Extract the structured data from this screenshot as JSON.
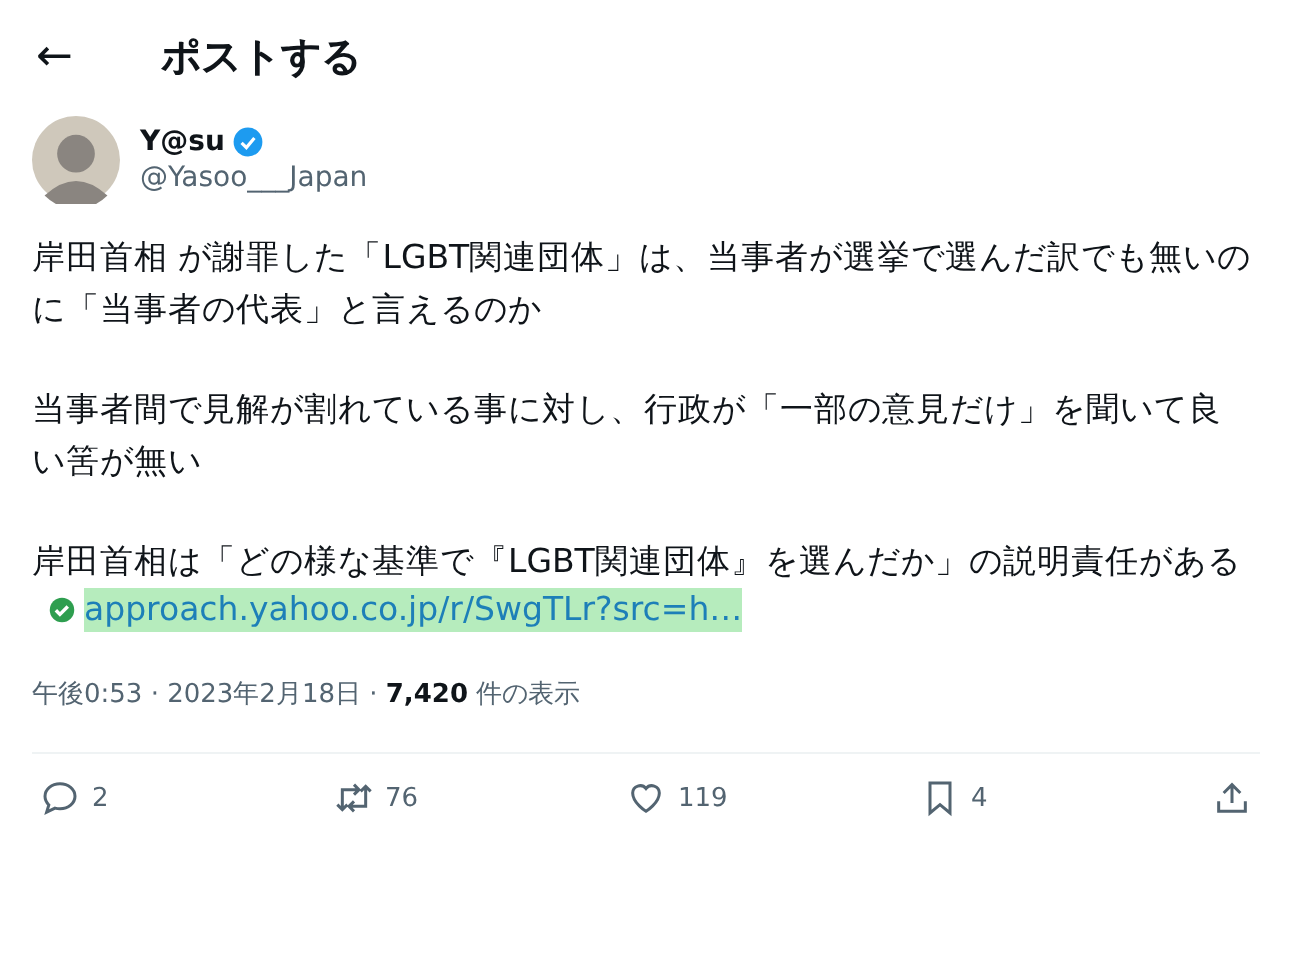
{
  "header": {
    "back": "←",
    "title": "ポストする"
  },
  "author": {
    "name": "Y@su",
    "handle": "@Yasoo___Japan",
    "verified": true
  },
  "paragraphs": [
    "岸田首相 が謝罪した「LGBT関連団体」は、当事者が選挙で選んだ訳でも無いのに「当事者の代表」と言えるのか",
    "当事者間で見解が割れている事に対し、行政が「一部の意見だけ」を聞いて良い筈が無い",
    "岸田首相は「どの様な基準で『LGBT関連団体』を選んだか」の説明責任がある"
  ],
  "link": "approach.yahoo.co.jp/r/SwgTLr?src=h…",
  "meta": "午後0:53 · 2023年2月18日 · **7,420** 件の表示",
  "actions": [
    {
      "kind": "reply",
      "count": "2"
    },
    {
      "kind": "repost",
      "count": "76"
    },
    {
      "kind": "like",
      "count": "119"
    },
    {
      "kind": "bookmark",
      "count": "4"
    },
    {
      "kind": "share"
    }
  ]
}
